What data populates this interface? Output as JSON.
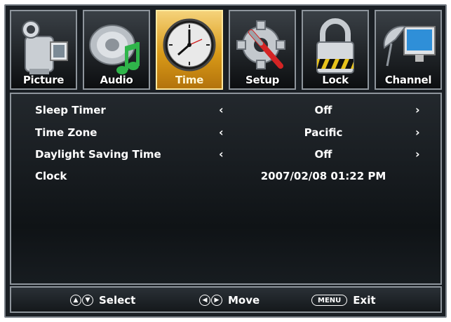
{
  "tabs": [
    {
      "label": "Picture",
      "icon": "camcorder-icon",
      "selected": false
    },
    {
      "label": "Audio",
      "icon": "speaker-note-icon",
      "selected": false
    },
    {
      "label": "Time",
      "icon": "clock-icon",
      "selected": true
    },
    {
      "label": "Setup",
      "icon": "gear-wrench-icon",
      "selected": false
    },
    {
      "label": "Lock",
      "icon": "padlock-icon",
      "selected": false
    },
    {
      "label": "Channel",
      "icon": "satellite-monitor-icon",
      "selected": false
    }
  ],
  "settings": [
    {
      "label": "Sleep Timer",
      "value": "Off",
      "left_arrow": "‹",
      "right_arrow": "›"
    },
    {
      "label": "Time Zone",
      "value": "Pacific",
      "left_arrow": "‹",
      "right_arrow": "›"
    },
    {
      "label": "Daylight Saving Time",
      "value": "Off",
      "left_arrow": "‹",
      "right_arrow": "›"
    },
    {
      "label": "Clock",
      "value": "2007/02/08 01:22 PM"
    }
  ],
  "footer": {
    "select_label": "Select",
    "move_label": "Move",
    "menu_key": "MENU",
    "exit_label": "Exit"
  },
  "colors": {
    "selected_tab": "#d99a18",
    "background": "#1a1f24",
    "text": "#ffffff"
  }
}
